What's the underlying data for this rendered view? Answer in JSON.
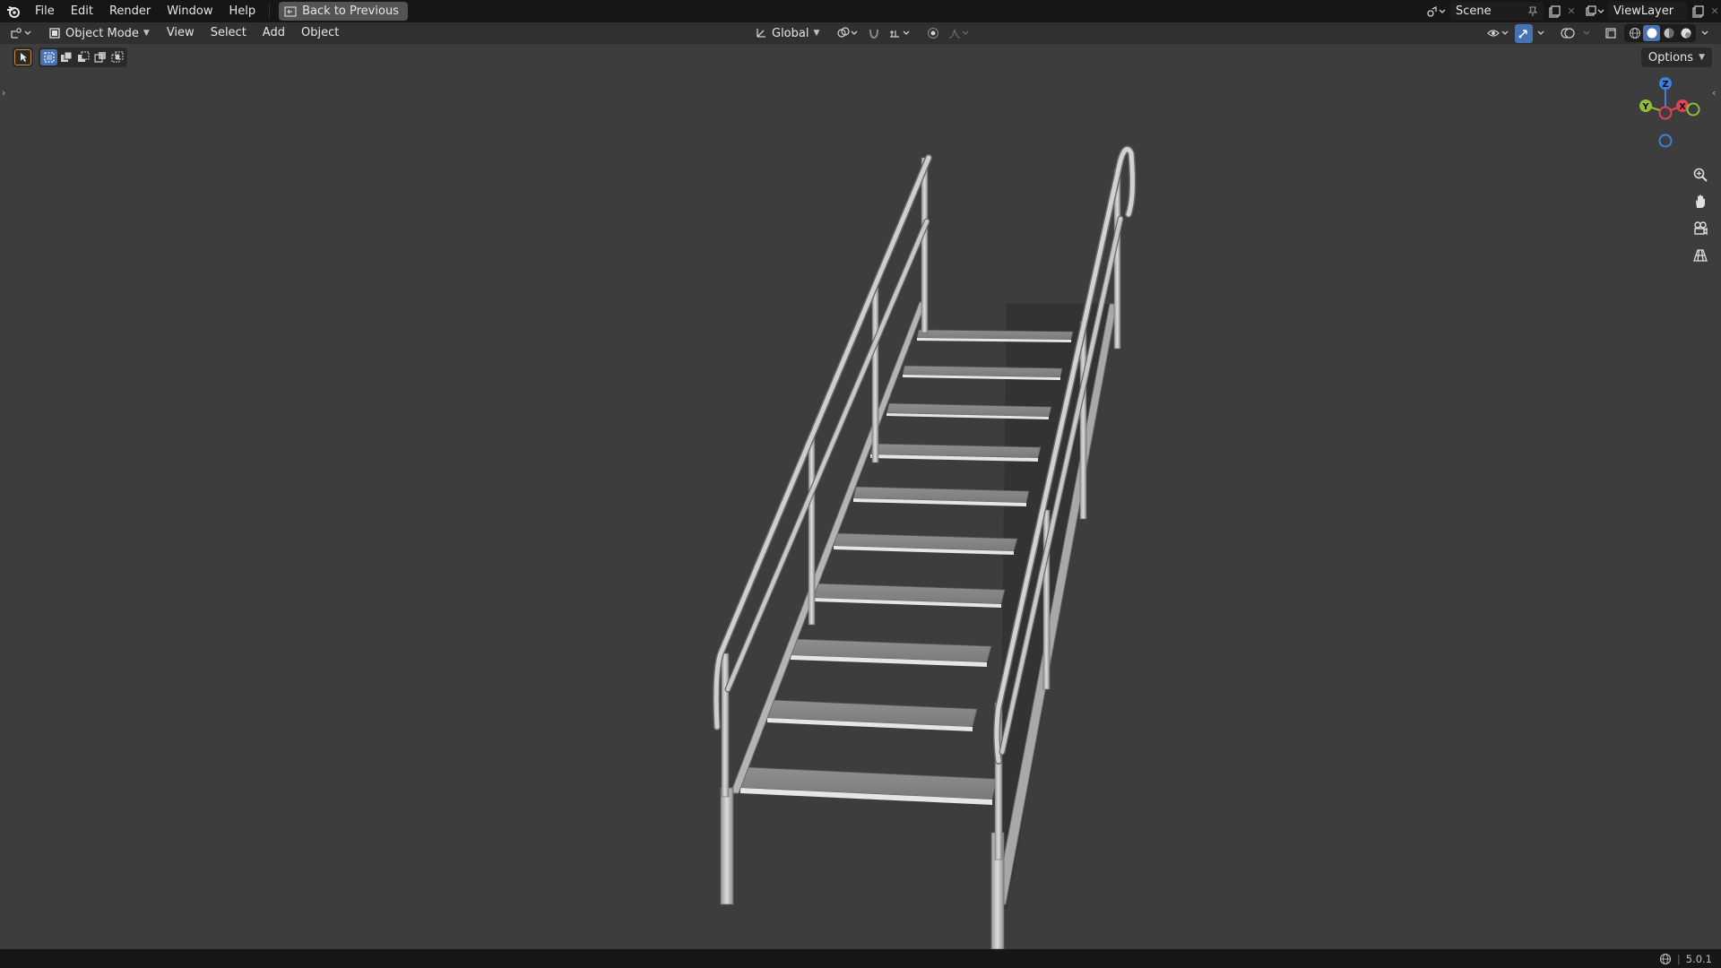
{
  "topbar": {
    "menus": [
      "File",
      "Edit",
      "Render",
      "Window",
      "Help"
    ],
    "back_button": "Back to Previous",
    "scene_name": "Scene",
    "view_layer": "ViewLayer"
  },
  "viewport_header": {
    "mode": "Object Mode",
    "menus": [
      "View",
      "Select",
      "Add",
      "Object"
    ],
    "transform_orientation": "Global",
    "options_label": "Options"
  },
  "gizmo": {
    "x_label": "X",
    "y_label": "Y",
    "z_label": "Z",
    "colors": {
      "x": "#e04455",
      "y": "#8fbf3a",
      "z": "#3b82e0"
    }
  },
  "navigation_icons": [
    "zoom-icon",
    "pan-hand-icon",
    "camera-icon",
    "perspective-grid-icon"
  ],
  "status_bar": {
    "version": "5.0.1"
  },
  "colors": {
    "accent": "#4772b3",
    "viewport_bg": "#3d3d3d",
    "header_bg": "#303030",
    "topbar_bg": "#161616"
  }
}
